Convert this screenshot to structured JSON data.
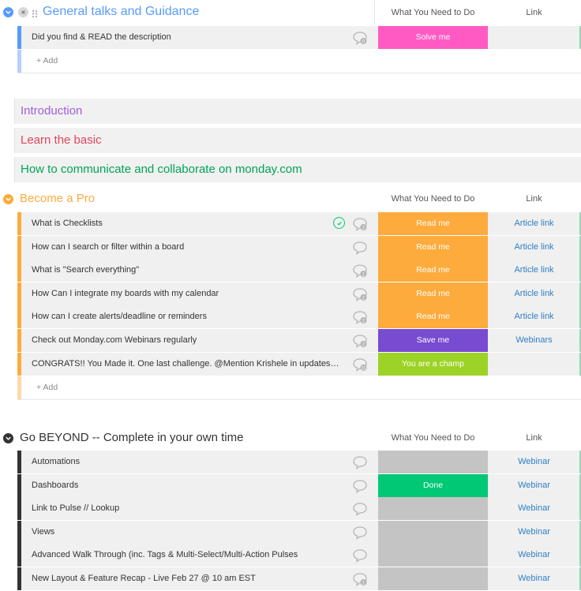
{
  "colors": {
    "blue": "#579bfc",
    "purple": "#a25ddc",
    "red": "#e2445c",
    "green": "#00a359",
    "orange": "#fdab3d",
    "black": "#333333",
    "pink": "#ff5ac4",
    "violet": "#784bd1",
    "lime": "#9cd326",
    "done": "#00c875",
    "empty": "#c4c4c4"
  },
  "groups": {
    "general": {
      "title": "General talks and Guidance",
      "col_status": "What You Need to Do",
      "col_link": "Link",
      "rows": [
        {
          "name": "Did you find & READ the description",
          "updates": "0",
          "status": "Solve me",
          "link": ""
        }
      ],
      "add_label": "+ Add"
    },
    "collapsed": [
      {
        "title": "Introduction"
      },
      {
        "title": "Learn the basic"
      },
      {
        "title": "How to communicate and collaborate on monday.com"
      }
    ],
    "pro": {
      "title": "Become a Pro",
      "col_status": "What You Need to Do",
      "col_link": "Link",
      "rows": [
        {
          "name": "What is Checklists",
          "updates": "2",
          "status": "Read me",
          "link": "Article link"
        },
        {
          "name": "How can I search or filter within a board",
          "updates": "",
          "status": "Read me",
          "link": "Article link"
        },
        {
          "name": "What is \"Search everything\"",
          "updates": "1",
          "status": "Read me",
          "link": "Article link"
        },
        {
          "name": "How Can I integrate my boards with my calendar",
          "updates": "1",
          "status": "Read me",
          "link": "Article link"
        },
        {
          "name": "How can I create alerts/deadline or reminders",
          "updates": "2",
          "status": "Read me",
          "link": "Article link"
        },
        {
          "name": "Check out Monday.com Webinars regularly",
          "updates": "2",
          "status": "Save me",
          "link": "Webinars"
        },
        {
          "name": "CONGRATS!! You Made it. One last challenge. @Mention Krishele in updates to ...",
          "updates": "11",
          "status": "You are a champ",
          "link": ""
        }
      ],
      "add_label": "+ Add"
    },
    "beyond": {
      "title": "Go BEYOND -- Complete in your own time",
      "col_status": "What You Need to Do",
      "col_link": "Link",
      "rows": [
        {
          "name": "Automations",
          "updates": "",
          "status": "",
          "link": "Webinar"
        },
        {
          "name": "Dashboards",
          "updates": "",
          "status": "Done",
          "link": "Webinar"
        },
        {
          "name": "Link to Pulse // Lookup",
          "updates": "",
          "status": "",
          "link": "Webinar"
        },
        {
          "name": "Views",
          "updates": "",
          "status": "",
          "link": "Webinar"
        },
        {
          "name": "Advanced Walk Through (inc. Tags & Multi-Select/Multi-Action Pulses",
          "updates": "",
          "status": "",
          "link": "Webinar"
        },
        {
          "name": "New Layout & Feature Recap - Live Feb 27 @ 10 am EST",
          "updates": "1",
          "status": "",
          "link": "Webinar"
        }
      ]
    }
  }
}
